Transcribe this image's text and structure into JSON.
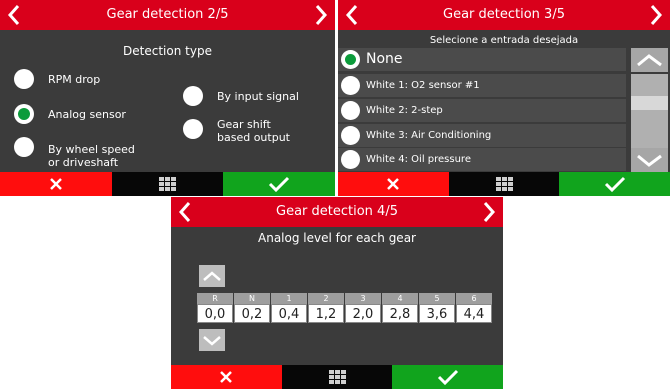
{
  "screen1": {
    "title": "Gear detection 2/5",
    "heading": "Detection type",
    "options": {
      "rpm_drop": "RPM drop",
      "analog_sensor": "Analog sensor",
      "wheel_speed_line1": "By wheel speed",
      "wheel_speed_line2": "or driveshaft",
      "input_signal": "By input signal",
      "gear_shift_line1": "Gear shift",
      "gear_shift_line2": "based output"
    },
    "selected": "Analog sensor"
  },
  "screen2": {
    "title": "Gear detection 3/5",
    "subtitle": "Selecione a entrada desejada",
    "items": [
      {
        "label": "None",
        "selected": true
      },
      {
        "label": "White 1: O2 sensor #1",
        "selected": false
      },
      {
        "label": "White 2: 2-step",
        "selected": false
      },
      {
        "label": "White 3: Air Conditioning",
        "selected": false
      },
      {
        "label": "White 4: Oil pressure",
        "selected": false
      }
    ]
  },
  "screen3": {
    "title": "Gear detection 4/5",
    "heading": "Analog level for each gear",
    "gears": [
      {
        "label": "R",
        "value": "0,0"
      },
      {
        "label": "N",
        "value": "0,2"
      },
      {
        "label": "1",
        "value": "0,4"
      },
      {
        "label": "2",
        "value": "1,2"
      },
      {
        "label": "3",
        "value": "2,0"
      },
      {
        "label": "4",
        "value": "2,8"
      },
      {
        "label": "5",
        "value": "3,6"
      },
      {
        "label": "6",
        "value": "4,4"
      }
    ]
  },
  "icons": {
    "back": "chevron-left-icon",
    "next": "chevron-right-icon",
    "cancel": "x-icon",
    "menu": "grid-icon",
    "confirm": "check-icon",
    "scroll_up": "chevron-up-icon",
    "scroll_down": "chevron-down-icon"
  },
  "colors": {
    "header": "#d9001b",
    "background": "#3b3b3b",
    "cancel": "#ff0d0d",
    "confirm": "#11a41d",
    "selected_radio": "#0c9b3b"
  }
}
